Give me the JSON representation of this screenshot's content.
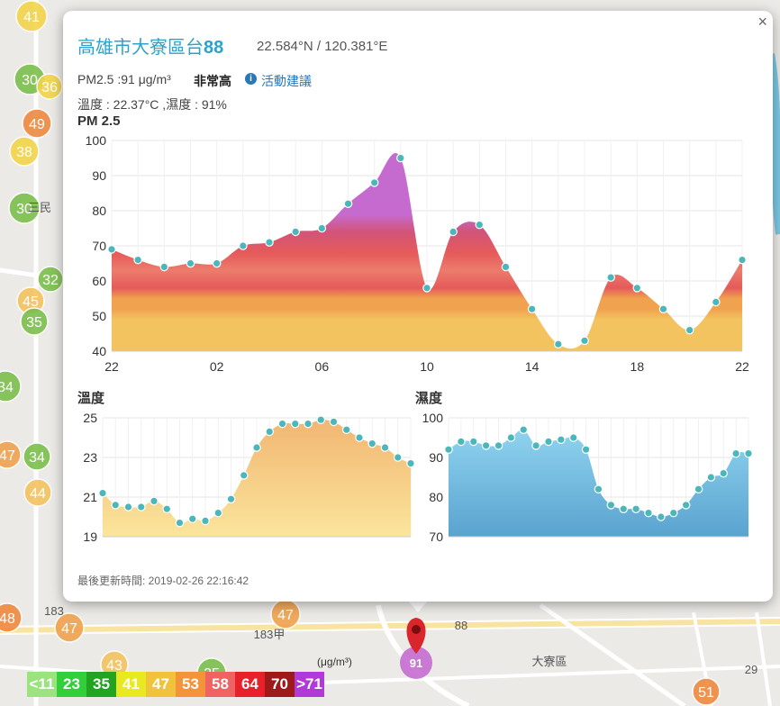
{
  "popup": {
    "station_name": "高雄市大寮區台",
    "station_number": "88",
    "coordinates": "22.584°N / 120.381°E",
    "close_label": "×",
    "pm_text": "PM2.5 :91 μg/m³",
    "level": "非常高",
    "info_icon": "info-icon",
    "advice_link": "活動建議",
    "temp_humidity": "溫度 : 22.37°C ,濕度 : 91%",
    "pm_chart_title": "PM 2.5",
    "temp_chart_title": "溫度",
    "humid_chart_title": "濕度",
    "last_updated": "最後更新時間: 2019-02-26 22:16:42"
  },
  "chart_data": [
    {
      "type": "area",
      "title": "PM 2.5",
      "x": [
        "22",
        "23",
        "00",
        "01",
        "02",
        "03",
        "04",
        "05",
        "06",
        "07",
        "08",
        "09",
        "10",
        "11",
        "12",
        "13",
        "14",
        "15",
        "16",
        "17",
        "18",
        "19",
        "20",
        "21",
        "22"
      ],
      "x_tick_labels": [
        "22",
        "02",
        "06",
        "10",
        "14",
        "18",
        "22"
      ],
      "values": [
        69,
        66,
        64,
        65,
        65,
        70,
        71,
        74,
        75,
        82,
        88,
        95,
        58,
        74,
        76,
        64,
        52,
        42,
        43,
        61,
        58,
        52,
        46,
        54,
        66
      ],
      "ylim": [
        40,
        100
      ],
      "y_ticks": [
        40,
        50,
        60,
        70,
        80,
        90,
        100
      ],
      "grid": true,
      "colors": {
        "purple": "#c56bd0",
        "red": "#e55a5a",
        "orange": "#f0a24f",
        "yellow": "#f2c35f",
        "point": "#4bb7bb"
      }
    },
    {
      "type": "area",
      "title": "溫度",
      "values": [
        21.2,
        20.6,
        20.5,
        20.5,
        20.8,
        20.4,
        19.7,
        19.9,
        19.8,
        20.2,
        20.9,
        22.1,
        23.5,
        24.3,
        24.7,
        24.7,
        24.7,
        24.9,
        24.8,
        24.4,
        24.0,
        23.7,
        23.5,
        23.0,
        22.7
      ],
      "ylim": [
        19,
        25
      ],
      "y_ticks": [
        19,
        21,
        23,
        25
      ],
      "grid": true,
      "colors": {
        "fill_top": "#f1b672",
        "fill_bottom": "#fbe59c",
        "point": "#4bb7bb"
      }
    },
    {
      "type": "area",
      "title": "濕度",
      "values": [
        92,
        94,
        94,
        93,
        93,
        95,
        97,
        93,
        94,
        94.5,
        95,
        92,
        82,
        78,
        77,
        77,
        76,
        75,
        76,
        78,
        82,
        85,
        86,
        91,
        91
      ],
      "ylim": [
        70,
        100
      ],
      "y_ticks": [
        70,
        80,
        90,
        100
      ],
      "grid": true,
      "colors": {
        "fill_top": "#8fd3ef",
        "fill_bottom": "#5aa3cf",
        "point": "#4bb7bb"
      }
    }
  ],
  "map": {
    "marker_value": "91",
    "labels": [
      {
        "text": "大寮區",
        "name": "district-label-daliao"
      },
      {
        "text": "183甲",
        "name": "road-label-183a"
      },
      {
        "text": "183",
        "name": "road-label-183"
      },
      {
        "text": "88",
        "name": "road-label-88"
      },
      {
        "text": "29",
        "name": "road-label-29"
      },
      {
        "text": "三民",
        "name": "district-label-sanmin"
      }
    ],
    "circles": [
      {
        "v": "41",
        "color": "#f2d44a"
      },
      {
        "v": "30",
        "color": "#7cbf4c"
      },
      {
        "v": "36",
        "color": "#f2d44a"
      },
      {
        "v": "49",
        "color": "#ef8a3f"
      },
      {
        "v": "38",
        "color": "#f2d44a"
      },
      {
        "v": "30",
        "color": "#7cbf4c"
      },
      {
        "v": "32",
        "color": "#7cbf4c"
      },
      {
        "v": "45",
        "color": "#f2c35f"
      },
      {
        "v": "35",
        "color": "#7cbf4c"
      },
      {
        "v": "34",
        "color": "#7cbf4c"
      },
      {
        "v": "34",
        "color": "#7cbf4c"
      },
      {
        "v": "47",
        "color": "#f0a24f"
      },
      {
        "v": "44",
        "color": "#f2c35f"
      },
      {
        "v": "48",
        "color": "#ef8a3f"
      },
      {
        "v": "47",
        "color": "#f0a24f"
      },
      {
        "v": "47",
        "color": "#f0a24f"
      },
      {
        "v": "43",
        "color": "#f2c35f"
      },
      {
        "v": "35",
        "color": "#7cbf4c"
      },
      {
        "v": "51",
        "color": "#ef8a3f"
      }
    ]
  },
  "legend": {
    "unit": "(μg/m³)",
    "items": [
      {
        "label": "<11",
        "color": "#9be37f"
      },
      {
        "label": "23",
        "color": "#31cf3a"
      },
      {
        "label": "35",
        "color": "#22a322"
      },
      {
        "label": "41",
        "color": "#e9e922"
      },
      {
        "label": "47",
        "color": "#f0c33a"
      },
      {
        "label": "53",
        "color": "#f3933a"
      },
      {
        "label": "58",
        "color": "#f06363"
      },
      {
        "label": "64",
        "color": "#e8202a"
      },
      {
        "label": "70",
        "color": "#9e1a1a"
      },
      {
        "label": ">71",
        "color": "#b03ad8"
      }
    ]
  }
}
